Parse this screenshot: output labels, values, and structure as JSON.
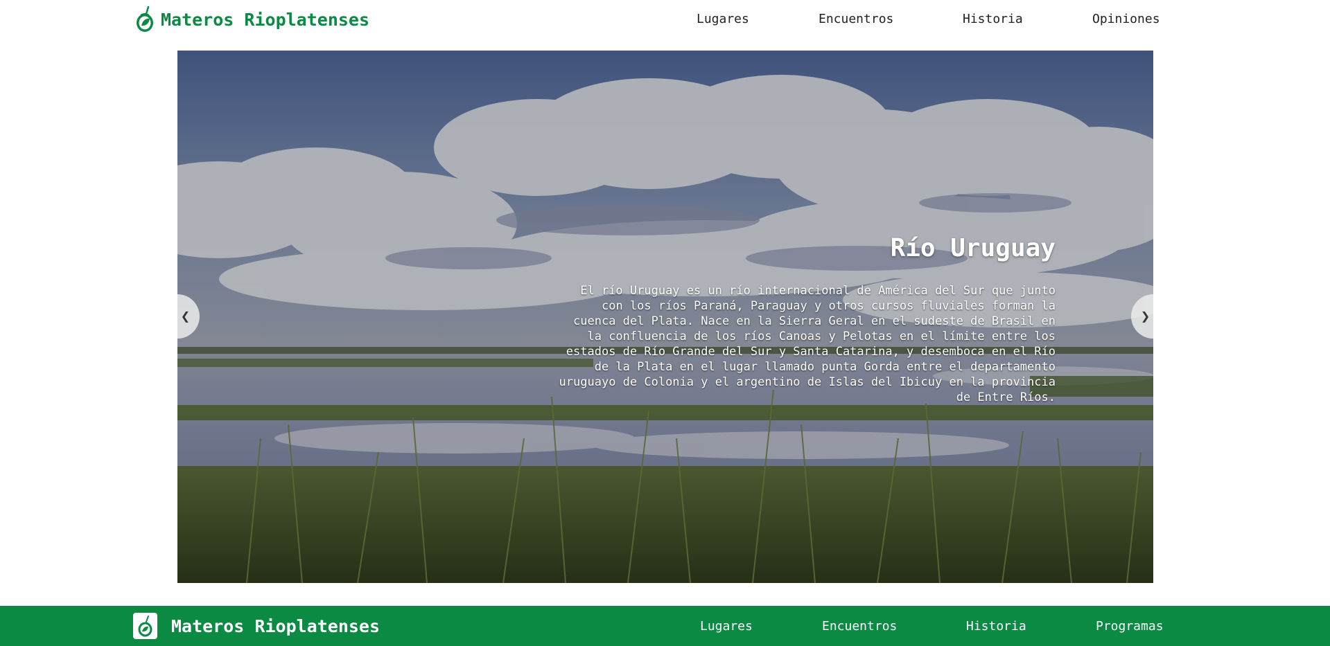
{
  "header": {
    "brand": "Materos Rioplatenses",
    "nav": [
      "Lugares",
      "Encuentros",
      "Historia",
      "Opiniones"
    ]
  },
  "carousel": {
    "title": "Río Uruguay",
    "text": "El río Uruguay es un río internacional de América del Sur que junto con los ríos Paraná, Paraguay y otros cursos fluviales forman la cuenca del Plata. Nace en la Sierra Geral en el sudeste de Brasil en la confluencia de los ríos Canoas y Pelotas en el límite entre los estados de Río Grande del Sur y Santa Catarina, y desemboca en el Río de la Plata en el lugar llamado punta Gorda entre el departamento uruguayo de Colonia y el argentino de Islas del Ibicuy en la provincia de Entre Ríos.",
    "prev_label": "❮",
    "next_label": "❯"
  },
  "footer": {
    "brand": "Materos Rioplatenses",
    "nav": [
      "Lugares",
      "Encuentros",
      "Historia",
      "Programas"
    ]
  },
  "colors": {
    "brand_green": "#0a8a43",
    "nav_text": "#222222"
  },
  "icons": {
    "logo": "mate-gourd-icon",
    "prev": "chevron-left-icon",
    "next": "chevron-right-icon"
  }
}
